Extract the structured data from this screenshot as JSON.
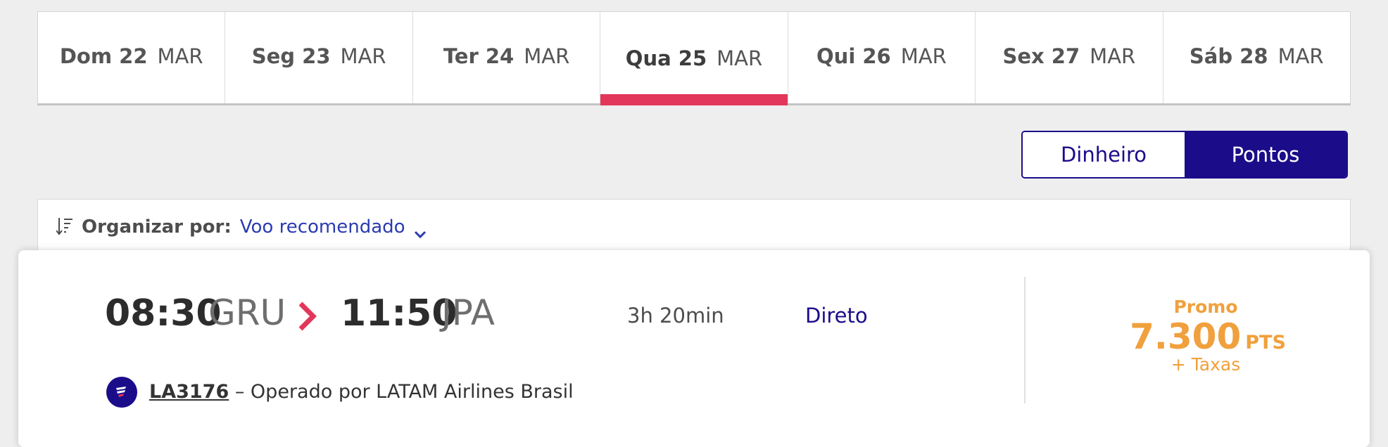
{
  "date_tabs": [
    {
      "day": "Dom 22",
      "month": "MAR"
    },
    {
      "day": "Seg 23",
      "month": "MAR"
    },
    {
      "day": "Ter 24",
      "month": "MAR"
    },
    {
      "day": "Qua 25",
      "month": "MAR",
      "selected": true
    },
    {
      "day": "Qui 26",
      "month": "MAR"
    },
    {
      "day": "Sex 27",
      "month": "MAR"
    },
    {
      "day": "Sáb 28",
      "month": "MAR"
    }
  ],
  "currency_toggle": {
    "money_label": "Dinheiro",
    "points_label": "Pontos",
    "selected": "Pontos"
  },
  "sort": {
    "label": "Organizar por:",
    "value": "Voo recomendado"
  },
  "flight": {
    "departure_time": "08:30",
    "departure_airport": "GRU",
    "arrival_time": "11:50",
    "arrival_airport": "JPA",
    "duration": "3h 20min",
    "stops": "Direto",
    "fare_label": "Promo",
    "price": "7.300",
    "price_unit": "PTS",
    "taxes": "+ Taxas",
    "flight_number": "LA3176",
    "operated_by": "– Operado por LATAM Airlines Brasil"
  },
  "colors": {
    "brand_navy": "#1b0c8a",
    "accent_red": "#e2375a",
    "promo_orange": "#f0a03c",
    "link_blue": "#2b3bb0"
  }
}
